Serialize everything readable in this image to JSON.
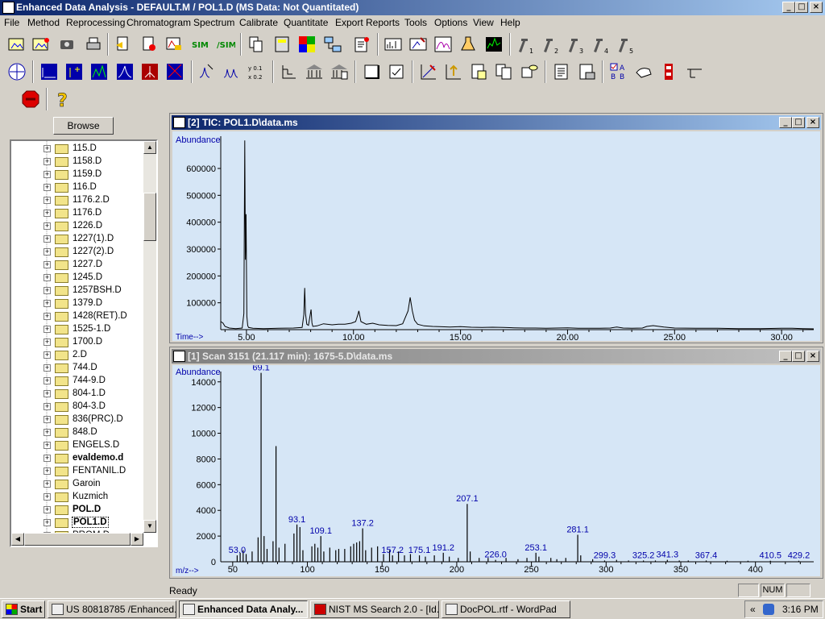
{
  "window": {
    "title": "Enhanced Data Analysis - DEFAULT.M / POL1.D    (MS Data: Not Quantitated)",
    "controls": [
      "_",
      "□",
      "×"
    ]
  },
  "menu": [
    "File",
    "Method",
    "Reprocessing",
    "Chromatogram",
    "Spectrum",
    "Calibrate",
    "Quantitate",
    "Export Reports",
    "Tools",
    "Options",
    "View",
    "Help"
  ],
  "toolbar": {
    "row1_icons": [
      "open-method-icon",
      "load-method-icon",
      "save-icon",
      "print-icon",
      "copy-icon",
      "export-icon",
      "integrate-icon",
      "sim-icon",
      "sim-2-icon",
      "edit-icon",
      "calc-icon",
      "color-icon",
      "network-icon",
      "report-icon",
      "spectrum-view-icon",
      "peak-icon",
      "chart-icon",
      "tic-icon",
      "hammer-1-icon",
      "hammer-2-icon",
      "hammer-3-icon",
      "hammer-4-icon",
      "hammer-5-icon"
    ],
    "hammer_labels": [
      "1",
      "2",
      "3",
      "4",
      "5"
    ],
    "row3_icons": [
      "stop-icon",
      "help-icon"
    ]
  },
  "browser": {
    "browse_label": "Browse",
    "items": [
      {
        "label": "115.D",
        "bold": false
      },
      {
        "label": "1158.D",
        "bold": false
      },
      {
        "label": "1159.D",
        "bold": false
      },
      {
        "label": "116.D",
        "bold": false
      },
      {
        "label": "1176.2.D",
        "bold": false
      },
      {
        "label": "1176.D",
        "bold": false
      },
      {
        "label": "1226.D",
        "bold": false
      },
      {
        "label": "1227(1).D",
        "bold": false
      },
      {
        "label": "1227(2).D",
        "bold": false
      },
      {
        "label": "1227.D",
        "bold": false
      },
      {
        "label": "1245.D",
        "bold": false
      },
      {
        "label": "1257BSH.D",
        "bold": false
      },
      {
        "label": "1379.D",
        "bold": false
      },
      {
        "label": "1428(RET).D",
        "bold": false
      },
      {
        "label": "1525-1.D",
        "bold": false
      },
      {
        "label": "1700.D",
        "bold": false
      },
      {
        "label": "2.D",
        "bold": false
      },
      {
        "label": "744.D",
        "bold": false
      },
      {
        "label": "744-9.D",
        "bold": false
      },
      {
        "label": "804-1.D",
        "bold": false
      },
      {
        "label": "804-3.D",
        "bold": false
      },
      {
        "label": "836(PRC).D",
        "bold": false
      },
      {
        "label": "848.D",
        "bold": false
      },
      {
        "label": "ENGELS.D",
        "bold": false
      },
      {
        "label": "evaldemo.d",
        "bold": true
      },
      {
        "label": "FENTANIL.D",
        "bold": false
      },
      {
        "label": "Garoin",
        "bold": false
      },
      {
        "label": "Kuzmich",
        "bold": false
      },
      {
        "label": "POL.D",
        "bold": true
      },
      {
        "label": "POL1.D",
        "bold": true
      },
      {
        "label": "PROM.D",
        "bold": false
      }
    ]
  },
  "tic_window": {
    "title": "[2] TIC: POL1.D\\data.ms"
  },
  "scan_window": {
    "title": "[1] Scan 3151 (21.117 min): 1675-5.D\\data.ms"
  },
  "chart_data": [
    {
      "type": "line",
      "ylabel": "Abundance",
      "xlabel": "Time-->",
      "xlim": [
        3.8,
        31.5
      ],
      "ylim": [
        0,
        720000
      ],
      "yticks": [
        100000,
        200000,
        300000,
        400000,
        500000,
        600000
      ],
      "ytick_labels": [
        "100000",
        "200000",
        "300000",
        "400000",
        "500000",
        "600000"
      ],
      "xticks": [
        5,
        10,
        15,
        20,
        25,
        30
      ],
      "xtick_labels": [
        "5.00",
        "10.00",
        "15.00",
        "20.00",
        "25.00",
        "30.00"
      ],
      "x": [
        3.8,
        3.9,
        4.0,
        4.2,
        4.5,
        4.8,
        4.88,
        4.92,
        4.95,
        4.98,
        5.02,
        5.06,
        5.1,
        5.3,
        5.8,
        6.5,
        7.2,
        7.6,
        7.68,
        7.72,
        7.76,
        7.82,
        7.9,
        8.02,
        8.06,
        8.1,
        8.3,
        8.6,
        9.0,
        9.3,
        9.6,
        9.9,
        10.1,
        10.2,
        10.25,
        10.35,
        10.6,
        10.9,
        11.2,
        11.6,
        12.0,
        12.3,
        12.55,
        12.65,
        12.75,
        12.85,
        13.0,
        13.3,
        13.7,
        14.0,
        14.5,
        15.0,
        15.5,
        16.0,
        16.5,
        17.0,
        17.5,
        18.0,
        18.5,
        19.0,
        19.5,
        20.0,
        20.5,
        21.0,
        21.5,
        22.0,
        22.3,
        22.6,
        23.0,
        23.5,
        23.7,
        24.0,
        24.5,
        25.0,
        26.0,
        27.0,
        28.0,
        29.0,
        30.0,
        30.5,
        31.0,
        31.5
      ],
      "y": [
        30000,
        25000,
        12000,
        6000,
        4000,
        6000,
        60000,
        704000,
        260000,
        430000,
        50000,
        15000,
        8000,
        5000,
        4000,
        5000,
        6000,
        8000,
        55000,
        155000,
        60000,
        20000,
        16000,
        75000,
        25000,
        12000,
        14000,
        22000,
        18000,
        20000,
        20000,
        24000,
        30000,
        55000,
        70000,
        30000,
        20000,
        24000,
        18000,
        16000,
        15000,
        22000,
        70000,
        120000,
        70000,
        35000,
        20000,
        14000,
        12000,
        11000,
        10000,
        11000,
        9000,
        8000,
        9000,
        8000,
        7000,
        6000,
        6000,
        5000,
        6000,
        7000,
        5000,
        5000,
        5000,
        6000,
        10000,
        6000,
        5000,
        6000,
        12000,
        15000,
        10000,
        6000,
        5000,
        5000,
        4000,
        4000,
        5000,
        5000,
        4000,
        3000
      ]
    },
    {
      "type": "bar",
      "ylabel": "Abundance",
      "xlabel": "m/z-->",
      "xlim": [
        42,
        439
      ],
      "ylim": [
        0,
        14800
      ],
      "yticks": [
        2000,
        4000,
        6000,
        8000,
        10000,
        12000,
        14000
      ],
      "ytick_labels": [
        "2000",
        "4000",
        "6000",
        "8000",
        "10000",
        "12000",
        "14000"
      ],
      "xticks": [
        50,
        100,
        150,
        200,
        250,
        300,
        350,
        400
      ],
      "xtick_labels": [
        "50",
        "100",
        "150",
        "200",
        "250",
        "300",
        "350",
        "400"
      ],
      "x": [
        53,
        55,
        57,
        59,
        63,
        67,
        69,
        71,
        73,
        77,
        79,
        81,
        85,
        91,
        93,
        95,
        97,
        103,
        105,
        107,
        109,
        111,
        115,
        119,
        121,
        125,
        129,
        131,
        133,
        135,
        137,
        139,
        143,
        147,
        151,
        155,
        157,
        161,
        165,
        169,
        175,
        179,
        185,
        191,
        195,
        201,
        207,
        209,
        215,
        221,
        226,
        233,
        241,
        247,
        253,
        255,
        263,
        267,
        273,
        281,
        283,
        291,
        299,
        307,
        315,
        325,
        333,
        341,
        349,
        355,
        367,
        381,
        395,
        410,
        429
      ],
      "values": [
        500,
        700,
        900,
        600,
        800,
        1900,
        14700,
        2000,
        1000,
        1600,
        9000,
        1100,
        1400,
        2200,
        2900,
        2700,
        900,
        1200,
        1400,
        1100,
        2000,
        800,
        1100,
        900,
        1000,
        1000,
        1200,
        1400,
        1500,
        1600,
        2600,
        900,
        1100,
        1200,
        600,
        900,
        500,
        800,
        500,
        600,
        500,
        400,
        500,
        700,
        400,
        300,
        4500,
        800,
        300,
        300,
        150,
        300,
        200,
        300,
        700,
        400,
        300,
        200,
        300,
        2100,
        500,
        200,
        100,
        150,
        100,
        100,
        100,
        150,
        100,
        100,
        100,
        80,
        80,
        80,
        80
      ],
      "labels": [
        {
          "text": "53.0",
          "x": 53,
          "y": 500
        },
        {
          "text": "69.1",
          "x": 69,
          "y": 14700
        },
        {
          "text": "93.1",
          "x": 93,
          "y": 2900
        },
        {
          "text": "109.1",
          "x": 109,
          "y": 2000
        },
        {
          "text": "137.2",
          "x": 137,
          "y": 2600
        },
        {
          "text": "157.2",
          "x": 157,
          "y": 500
        },
        {
          "text": "175.1",
          "x": 175,
          "y": 500
        },
        {
          "text": "191.2",
          "x": 191,
          "y": 700
        },
        {
          "text": "207.1",
          "x": 207,
          "y": 4500
        },
        {
          "text": "226.0",
          "x": 226,
          "y": 150
        },
        {
          "text": "253.1",
          "x": 253,
          "y": 700
        },
        {
          "text": "281.1",
          "x": 281,
          "y": 2100
        },
        {
          "text": "299.3",
          "x": 299,
          "y": 100
        },
        {
          "text": "325.2",
          "x": 325,
          "y": 100
        },
        {
          "text": "341.3",
          "x": 341,
          "y": 150
        },
        {
          "text": "367.4",
          "x": 367,
          "y": 100
        },
        {
          "text": "410.5",
          "x": 410,
          "y": 80
        },
        {
          "text": "429.2",
          "x": 429,
          "y": 80
        }
      ]
    }
  ],
  "status": {
    "text": "Ready",
    "num": "NUM"
  },
  "taskbar": {
    "start": "Start",
    "tasks": [
      "US 80818785 /Enhanced...",
      "Enhanced Data Analy...",
      "NIST MS Search 2.0 - [Id...",
      "DocPOL.rtf - WordPad"
    ],
    "clock": "3:16 PM",
    "tray_chevron": "«"
  }
}
